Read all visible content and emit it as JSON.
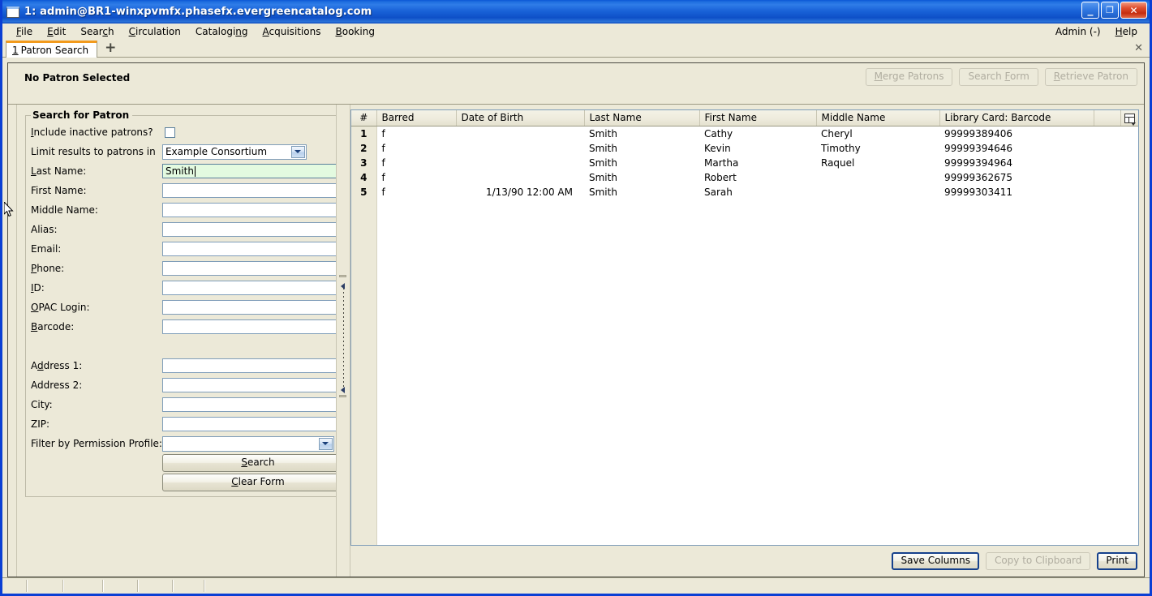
{
  "window": {
    "title": "1: admin@BR1-winxpvmfx.phasefx.evergreencatalog.com",
    "icon": "window-icon",
    "minimize_label": "_",
    "maximize_label": "❐",
    "close_label": "✕"
  },
  "menubar": {
    "items": [
      {
        "label": "File",
        "accel_index": 0
      },
      {
        "label": "Edit",
        "accel_index": 0
      },
      {
        "label": "Search",
        "accel_index": 4
      },
      {
        "label": "Circulation",
        "accel_index": 0
      },
      {
        "label": "Cataloging",
        "accel_index": 7
      },
      {
        "label": "Acquisitions",
        "accel_index": 0
      },
      {
        "label": "Booking",
        "accel_index": 0
      }
    ],
    "right_items": [
      {
        "label": "Admin (-)"
      },
      {
        "label": "Help",
        "accel_index": 0
      }
    ]
  },
  "tabstrip": {
    "tabs": [
      {
        "number": "1",
        "label": "Patron Search"
      }
    ],
    "new_tab_label": "+",
    "close_label": "✕"
  },
  "patron_bar": {
    "status": "No Patron Selected",
    "actions": [
      {
        "label": "Merge Patrons",
        "disabled": true
      },
      {
        "label": "Search Form",
        "disabled": true
      },
      {
        "label": "Retrieve Patron",
        "disabled": true
      }
    ]
  },
  "search_form": {
    "legend": "Search for Patron",
    "include_inactive": {
      "label": "Include inactive patrons?",
      "checked": false
    },
    "limit_results": {
      "label": "Limit results to patrons in",
      "value": "Example Consortium"
    },
    "fields": [
      {
        "label": "Last Name:",
        "value": "Smith",
        "focused": true,
        "placeholder": ""
      },
      {
        "label": "First Name:",
        "value": "",
        "focused": false,
        "placeholder": ""
      },
      {
        "label": "Middle Name:",
        "value": "",
        "focused": false,
        "placeholder": ""
      },
      {
        "label": "Alias:",
        "value": "",
        "focused": false,
        "placeholder": ""
      },
      {
        "label": "Email:",
        "value": "",
        "focused": false,
        "placeholder": ""
      },
      {
        "label": "Phone:",
        "value": "",
        "focused": false,
        "placeholder": ""
      },
      {
        "label": "ID:",
        "value": "",
        "focused": false,
        "placeholder": ""
      },
      {
        "label": "OPAC Login:",
        "value": "",
        "focused": false,
        "placeholder": ""
      },
      {
        "label": "Barcode:",
        "value": "",
        "focused": false,
        "placeholder": ""
      }
    ],
    "address_fields": [
      {
        "label": "Address 1:",
        "value": "",
        "placeholder": ""
      },
      {
        "label": "Address 2:",
        "value": "",
        "placeholder": ""
      },
      {
        "label": "City:",
        "value": "",
        "placeholder": ""
      },
      {
        "label": "ZIP:",
        "value": "",
        "placeholder": ""
      }
    ],
    "permission_profile": {
      "label": "Filter by Permission Profile:",
      "value": ""
    },
    "search_button": "Search",
    "clear_button": "Clear Form"
  },
  "results": {
    "columns": [
      {
        "key": "num",
        "label": "#"
      },
      {
        "key": "barred",
        "label": "Barred"
      },
      {
        "key": "dob",
        "label": "Date of Birth"
      },
      {
        "key": "last",
        "label": "Last Name"
      },
      {
        "key": "first",
        "label": "First Name"
      },
      {
        "key": "middle",
        "label": "Middle Name"
      },
      {
        "key": "barcode",
        "label": "Library Card: Barcode"
      }
    ],
    "column_picker_icon": "column-picker-icon",
    "rows": [
      {
        "num": "1",
        "barred": "f",
        "dob": "",
        "last": "Smith",
        "first": "Cathy",
        "middle": "Cheryl",
        "barcode": "99999389406"
      },
      {
        "num": "2",
        "barred": "f",
        "dob": "",
        "last": "Smith",
        "first": "Kevin",
        "middle": "Timothy",
        "barcode": "99999394646"
      },
      {
        "num": "3",
        "barred": "f",
        "dob": "",
        "last": "Smith",
        "first": "Martha",
        "middle": "Raquel",
        "barcode": "99999394964"
      },
      {
        "num": "4",
        "barred": "f",
        "dob": "",
        "last": "Smith",
        "first": "Robert",
        "middle": "",
        "barcode": "99999362675"
      },
      {
        "num": "5",
        "barred": "f",
        "dob": "1/13/90 12:00 AM",
        "last": "Smith",
        "first": "Sarah",
        "middle": "",
        "barcode": "99999303411"
      }
    ],
    "actions": [
      {
        "label": "Save Columns",
        "disabled": false,
        "default": true
      },
      {
        "label": "Copy to Clipboard",
        "disabled": true,
        "default": false
      },
      {
        "label": "Print",
        "disabled": false,
        "default": true
      }
    ]
  },
  "statusbar": {
    "cells": [
      "",
      "",
      "",
      "",
      "",
      "",
      ""
    ]
  },
  "colors": {
    "titlebar_blue": "#1a63d8",
    "window_border": "#0a3fd4",
    "chrome_beige": "#ece9d8",
    "active_tab_accent": "#f29a1c",
    "focused_field_green": "#e3fae0",
    "field_border": "#7f9db9",
    "default_button_border": "#16418c"
  }
}
